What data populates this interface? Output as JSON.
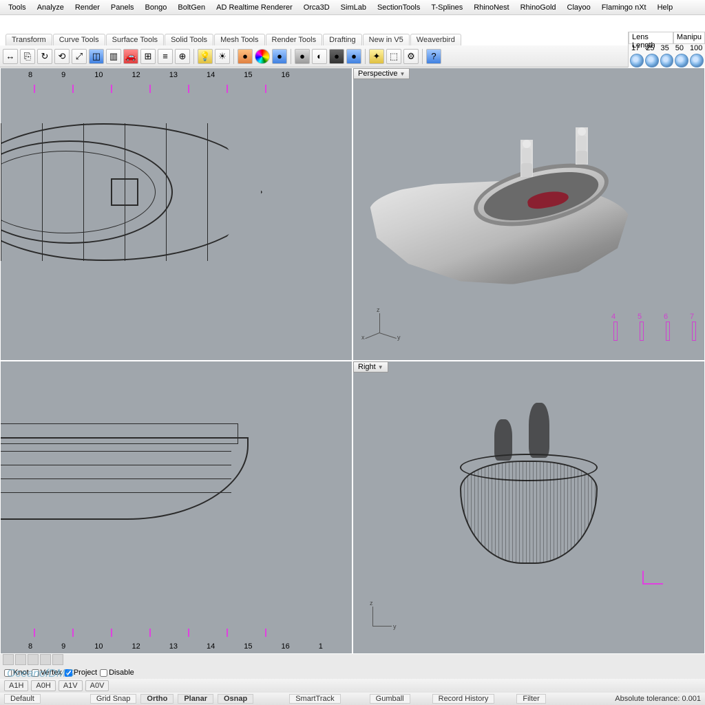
{
  "menu": [
    "Tools",
    "Analyze",
    "Render",
    "Panels",
    "Bongo",
    "BoltGen",
    "AD Realtime Renderer",
    "Orca3D",
    "SimLab",
    "SectionTools",
    "T-Splines",
    "RhinoNest",
    "RhinoGold",
    "Clayoo",
    "Flamingo nXt",
    "Help"
  ],
  "menu_u": [
    3,
    0,
    0,
    0,
    0,
    0,
    0,
    4,
    0,
    0,
    2,
    0,
    5,
    0,
    9,
    0
  ],
  "tabs": [
    "Transform",
    "Curve Tools",
    "Surface Tools",
    "Solid Tools",
    "Mesh Tools",
    "Render Tools",
    "Drafting",
    "New in V5",
    "Weaverbird"
  ],
  "lens": {
    "tab1": "Lens Length",
    "tab2": "Manipu",
    "nums": [
      "17",
      "25",
      "35",
      "50",
      "100"
    ]
  },
  "viewport": {
    "perspective": "Perspective",
    "right": "Right"
  },
  "ruler_top": [
    "8",
    "9",
    "10",
    "12",
    "13",
    "14",
    "15",
    "16"
  ],
  "ruler_bot": [
    "8",
    "9",
    "10",
    "12",
    "13",
    "14",
    "15",
    "16",
    "1"
  ],
  "axis": {
    "x": "x",
    "y": "y",
    "z": "z"
  },
  "marks": [
    "4",
    "5",
    "6",
    "7"
  ],
  "status_tabs": [
    "A1H",
    "A0H",
    "A1V",
    "A0V"
  ],
  "checks": {
    "knot": "Knot",
    "vertex": "Vertex",
    "project": "Project",
    "disable": "Disable"
  },
  "status2": {
    "default": "Default",
    "gridsnap": "Grid Snap",
    "ortho": "Ortho",
    "planar": "Planar",
    "osnap": "Osnap",
    "smart": "SmartTrack",
    "gumball": "Gumball",
    "record": "Record History",
    "filter": "Filter",
    "tol": "Absolute tolerance: 0.001"
  },
  "watermark": "OceanofDMG"
}
